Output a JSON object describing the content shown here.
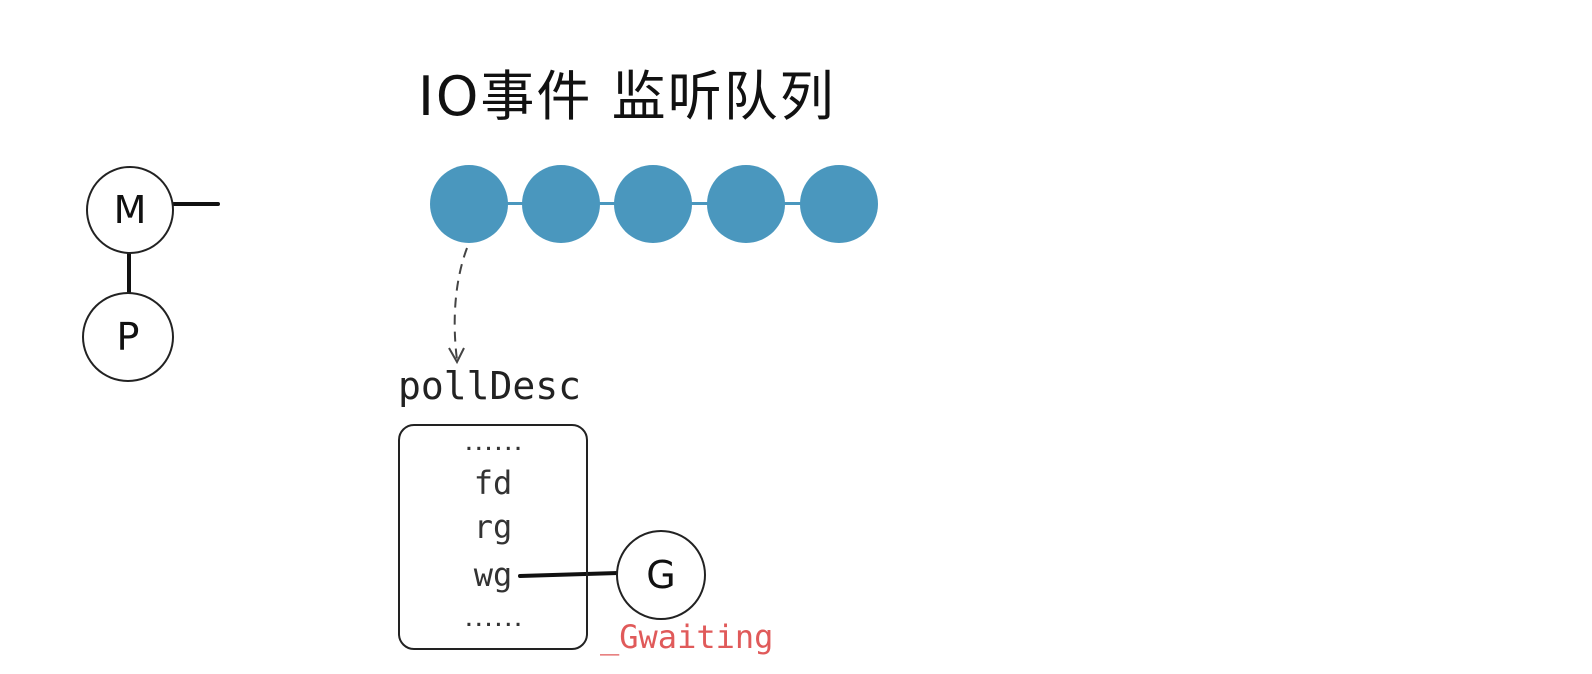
{
  "title": "IO事件 监听队列",
  "nodes": {
    "m": "M",
    "p": "P",
    "g": "G"
  },
  "queue": {
    "item_count": 5,
    "color": "#4a97be"
  },
  "struct": {
    "name": "pollDesc",
    "fields": [
      "......",
      "fd",
      "rg",
      "wg",
      "......"
    ]
  },
  "goroutine_state": "_Gwaiting",
  "colors": {
    "queue": "#4a97be",
    "state": "#e05a5a",
    "ink": "#222222"
  }
}
